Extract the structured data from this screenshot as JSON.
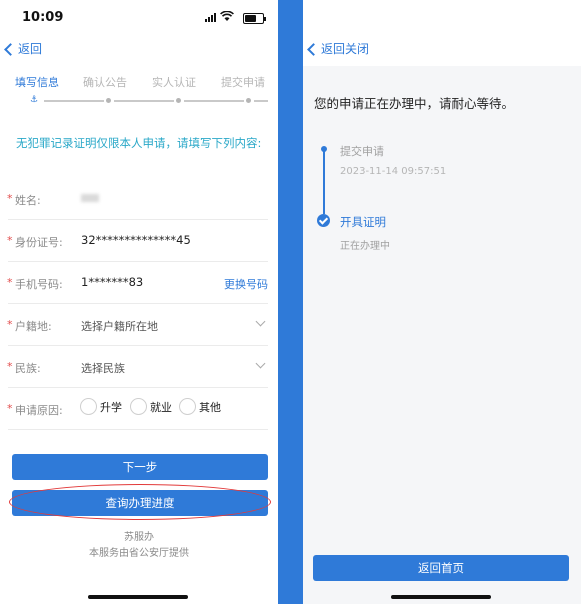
{
  "status_bar": {
    "time": "10:09"
  },
  "left": {
    "nav": {
      "back_label": "返回"
    },
    "steps": [
      "填写信息",
      "确认公告",
      "实人认证",
      "提交申请"
    ],
    "notice": "无犯罪记录证明仅限本人申请，请填写下列内容:",
    "form": {
      "required_mark": "*",
      "name_label": "姓名:",
      "id_label": "身份证号:",
      "id_value": "32**************45",
      "phone_label": "手机号码:",
      "phone_value": "1*******83",
      "change_phone": "更换号码",
      "household_label": "户籍地:",
      "household_placeholder": "选择户籍所在地",
      "ethnicity_label": "民族:",
      "ethnicity_placeholder": "选择民族",
      "reason_label": "申请原因:",
      "reasons": [
        "升学",
        "就业",
        "其他"
      ]
    },
    "next_button": "下一步",
    "progress_button": "查询办理进度",
    "footer_line1": "苏服办",
    "footer_line2": "本服务由省公安厅提供"
  },
  "right": {
    "nav": {
      "back_label": "返回",
      "close_label": "关闭"
    },
    "message": "您的申请正在办理中，请耐心等待。",
    "timeline": [
      {
        "title": "提交申请",
        "sub": "2023-11-14 09:57:51"
      },
      {
        "title": "开具证明",
        "sub": "正在办理中"
      }
    ],
    "home_button": "返回首页"
  },
  "colors": {
    "accent": "#2f7ad8",
    "notice": "#2aa8c8",
    "required": "#e24c4c",
    "annotation": "#e23a3a"
  }
}
